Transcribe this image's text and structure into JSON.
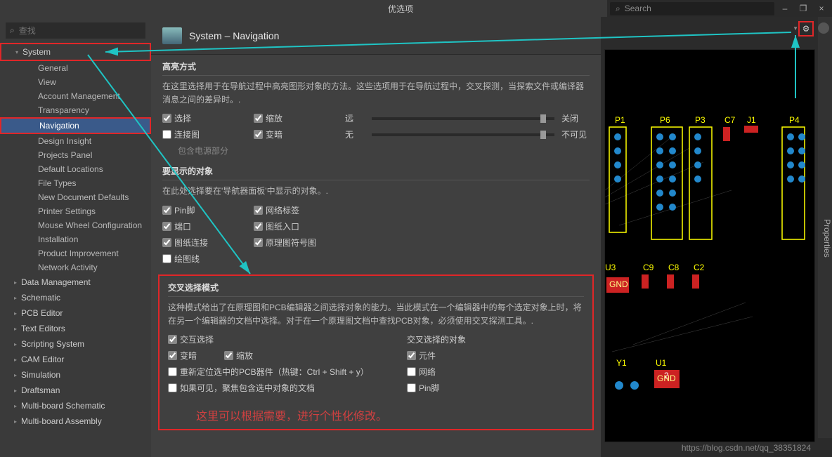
{
  "dialog": {
    "title": "优选项",
    "close_char": "×"
  },
  "topbar": {
    "search_placeholder": "Search",
    "min": "–",
    "max": "❐",
    "close": "×"
  },
  "search": {
    "placeholder": "查找"
  },
  "sidebar": {
    "categories": [
      {
        "label": "System",
        "open": true,
        "red": true,
        "subs": [
          {
            "label": "General"
          },
          {
            "label": "View"
          },
          {
            "label": "Account Management"
          },
          {
            "label": "Transparency"
          },
          {
            "label": "Navigation",
            "sel": true,
            "red": true
          },
          {
            "label": "Design Insight"
          },
          {
            "label": "Projects Panel"
          },
          {
            "label": "Default Locations"
          },
          {
            "label": "File Types"
          },
          {
            "label": "New Document Defaults"
          },
          {
            "label": "Printer Settings"
          },
          {
            "label": "Mouse Wheel Configuration"
          },
          {
            "label": "Installation"
          },
          {
            "label": "Product Improvement"
          },
          {
            "label": "Network Activity"
          }
        ]
      },
      {
        "label": "Data Management"
      },
      {
        "label": "Schematic"
      },
      {
        "label": "PCB Editor"
      },
      {
        "label": "Text Editors"
      },
      {
        "label": "Scripting System"
      },
      {
        "label": "CAM Editor"
      },
      {
        "label": "Simulation"
      },
      {
        "label": "Draftsman"
      },
      {
        "label": "Multi-board Schematic"
      },
      {
        "label": "Multi-board Assembly"
      }
    ]
  },
  "panel_title": "System – Navigation",
  "properties_tab": "Properties",
  "highlight": {
    "title": "高亮方式",
    "desc": "在这里选择用于在导航过程中高亮图形对象的方法。这些选项用于在导航过程中，交叉探测，当探索文件或编译器消息之间的差异时。.",
    "sel": "选择",
    "zoom": "缩放",
    "dim": "变暗",
    "conn": "连接图",
    "far": "远",
    "off": "关闭",
    "none": "无",
    "invisible": "不可见",
    "include_power": "包含电源部分"
  },
  "objects": {
    "title": "要显示的对象",
    "desc": "在此处选择要在'导航器面板'中显示的对象。.",
    "pin": "Pin脚",
    "netlabel": "网络标签",
    "port": "端口",
    "sheet_entry": "图纸入口",
    "sheet_conn": "图纸连接",
    "sch_sym": "原理图符号图",
    "draw_line": "绘图线"
  },
  "cross": {
    "title": "交叉选择模式",
    "desc": "这种模式给出了在原理图和PCB编辑器之间选择对象的能力。当此模式在一个编辑器中的每个选定对象上时，将在另一个编辑器的文档中选择。对于在一个原理图文档中查找PCB对象，必须使用交叉探测工具。.",
    "interact": "交互选择",
    "target_title": "交叉选择的对象",
    "dim": "变暗",
    "zoom": "缩放",
    "comp": "元件",
    "reloc": "重新定位选中的PCB器件（热键：Ctrl + Shift + y）",
    "net": "网络",
    "focus": "如果可见，聚焦包含选中对象的文档",
    "pin": "Pin脚",
    "note": "这里可以根据需要，进行个性化修改。"
  },
  "pcb_refs": [
    "P1",
    "P6",
    "P3",
    "C7",
    "J1",
    "P4",
    "U3",
    "C9",
    "C8",
    "C2",
    "Y1",
    "U1"
  ],
  "watermark": "https://blog.csdn.net/qq_38351824",
  "icons": {
    "search": "⌕",
    "gear": "⚙"
  }
}
